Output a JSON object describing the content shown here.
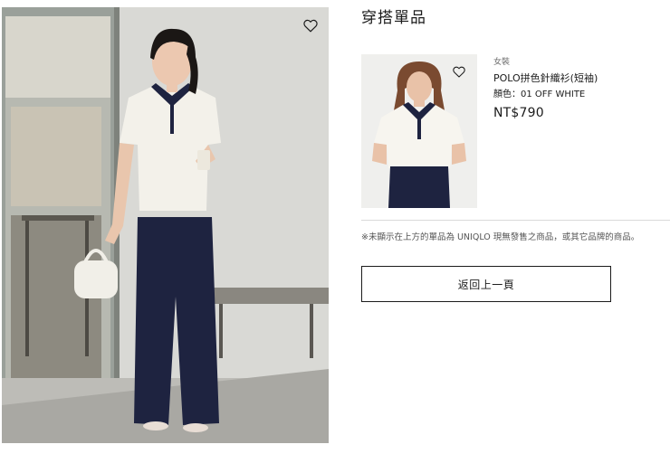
{
  "hero": {
    "favorite_icon": "heart-outline-icon"
  },
  "section": {
    "title": "穿搭單品"
  },
  "product": {
    "gender": "女裝",
    "name": "POLO拼色針織衫(短袖)",
    "color": "顏色：01 OFF WHITE",
    "price": "NT$790",
    "favorite_icon": "heart-outline-icon"
  },
  "disclaimer": "※未顯示在上方的單品為 UNIQLO 現無發售之商品，或其它品牌的商品。",
  "back_button": {
    "label": "返回上一頁"
  },
  "colors": {
    "text": "#1b1b1b",
    "muted": "#6f6f6f",
    "divider": "#dadada",
    "navy": "#1d2340",
    "off_white": "#f3f1ea"
  }
}
